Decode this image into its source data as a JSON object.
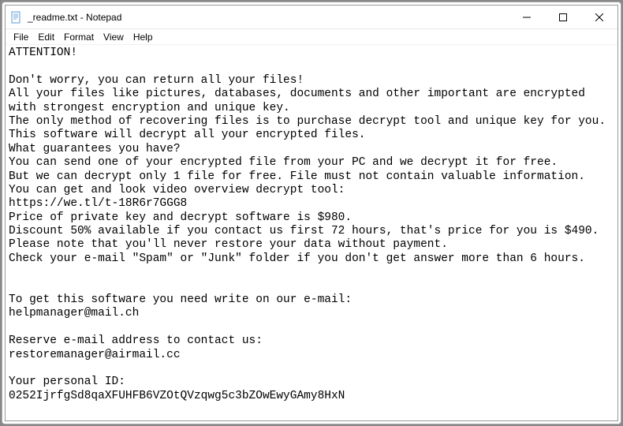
{
  "window": {
    "title": "_readme.txt - Notepad"
  },
  "menu": {
    "file": "File",
    "edit": "Edit",
    "format": "Format",
    "view": "View",
    "help": "Help"
  },
  "content": {
    "text": "ATTENTION!\n\nDon't worry, you can return all your files!\nAll your files like pictures, databases, documents and other important are encrypted with strongest encryption and unique key.\nThe only method of recovering files is to purchase decrypt tool and unique key for you.\nThis software will decrypt all your encrypted files.\nWhat guarantees you have?\nYou can send one of your encrypted file from your PC and we decrypt it for free.\nBut we can decrypt only 1 file for free. File must not contain valuable information.\nYou can get and look video overview decrypt tool:\nhttps://we.tl/t-18R6r7GGG8\nPrice of private key and decrypt software is $980.\nDiscount 50% available if you contact us first 72 hours, that's price for you is $490.\nPlease note that you'll never restore your data without payment.\nCheck your e-mail \"Spam\" or \"Junk\" folder if you don't get answer more than 6 hours.\n\n\nTo get this software you need write on our e-mail:\nhelpmanager@mail.ch\n\nReserve e-mail address to contact us:\nrestoremanager@airmail.cc\n\nYour personal ID:\n0252IjrfgSd8qaXFUHFB6VZOtQVzqwg5c3bZOwEwyGAmy8HxN"
  }
}
